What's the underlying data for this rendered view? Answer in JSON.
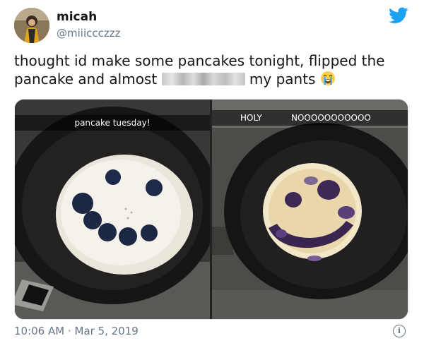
{
  "author": {
    "name": "micah",
    "handle": "@miiiccczzz"
  },
  "tweet": {
    "text_before": "thought id make some pancakes tonight, flipped the pancake and almost",
    "text_after": "my pants",
    "emoji_icon": "loudly-crying-face-icon"
  },
  "media": {
    "left_caption": "pancake tuesday!",
    "right_caption_left": "HOLY",
    "right_caption_right": "NOOOOOOOOOOO"
  },
  "footer": {
    "timestamp": "10:06 AM · Mar 5, 2019"
  },
  "colors": {
    "twitter_blue": "#1da1f2",
    "secondary_text": "#657786"
  }
}
